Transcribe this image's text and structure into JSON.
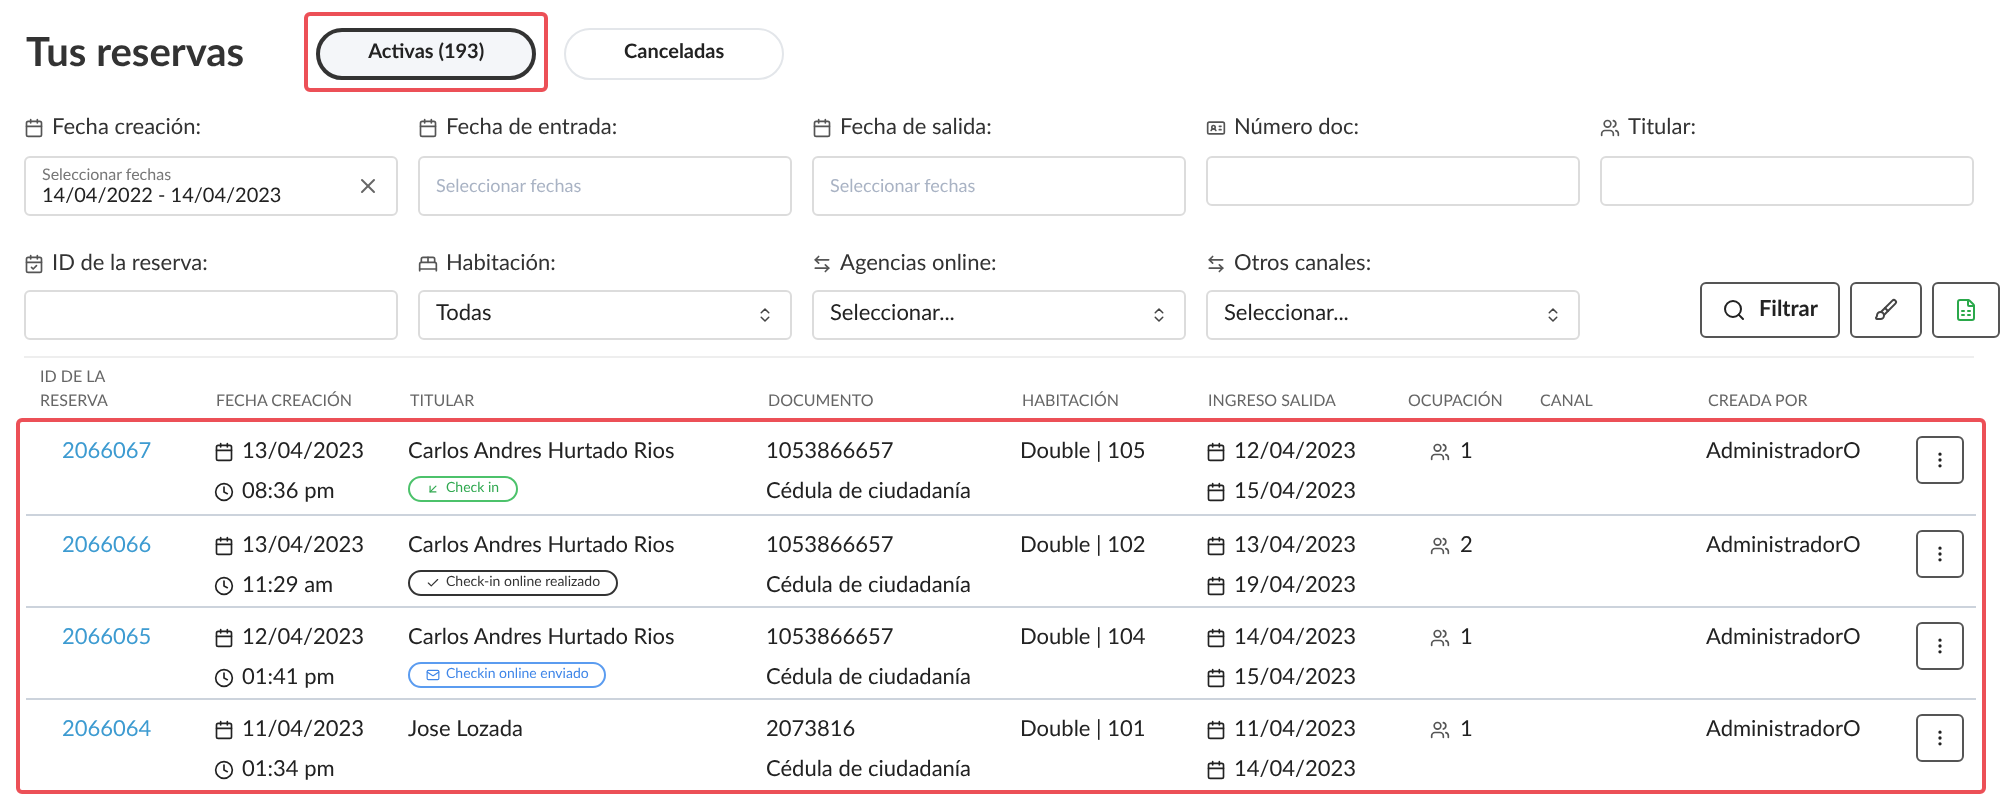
{
  "title": "Tus reservas",
  "tabs": [
    {
      "label": "Activas (193)",
      "selected": true,
      "highlighted": true
    },
    {
      "label": "Canceladas",
      "selected": false,
      "highlighted": false
    }
  ],
  "filters": [
    {
      "kind": "date",
      "label": "Fecha creación:",
      "placeholder": "Seleccionar fechas",
      "value": "14/04/2022 - 14/04/2023"
    },
    {
      "kind": "date",
      "label": "Fecha de entrada:",
      "placeholder": "Seleccionar fechas"
    },
    {
      "kind": "date",
      "label": "Fecha de salida:",
      "placeholder": "Seleccionar fechas"
    },
    {
      "kind": "text",
      "label": "Número doc:"
    },
    {
      "kind": "text",
      "label": "Titular:"
    },
    {
      "kind": "text",
      "label": "ID de la reserva:"
    },
    {
      "kind": "select",
      "label": "Habitación:",
      "value": "Todas"
    },
    {
      "kind": "select",
      "label": "Agencias online:",
      "value": "Seleccionar..."
    },
    {
      "kind": "select",
      "label": "Otros canales:",
      "value": "Seleccionar..."
    }
  ],
  "filter_button": "Filtrar",
  "table": {
    "highlighted": true,
    "columns": [
      "ID DE LA RESERVA",
      "FECHA CREACIÓN",
      "TITULAR",
      "DOCUMENTO",
      "HABITACIÓN",
      "INGRESO SALIDA",
      "OCUPACIÓN",
      "CANAL",
      "CREADA POR"
    ],
    "rows": [
      {
        "id": "2066067",
        "date": "13/04/2023",
        "time": "08:36 pm",
        "holder": "Carlos Andres Hurtado Rios",
        "badge": {
          "kind": "checkin",
          "label": "Check in"
        },
        "doc_number": "1053866657",
        "doc_type": "Cédula de ciudadanía",
        "room": "Double | 105",
        "check_in": "12/04/2023",
        "check_out": "15/04/2023",
        "occupancy": "1",
        "created_by": "AdministradorO"
      },
      {
        "id": "2066066",
        "date": "13/04/2023",
        "time": "11:29 am",
        "holder": "Carlos Andres Hurtado Rios",
        "badge": {
          "kind": "done",
          "label": "Check-in online realizado"
        },
        "doc_number": "1053866657",
        "doc_type": "Cédula de ciudadanía",
        "room": "Double | 102",
        "check_in": "13/04/2023",
        "check_out": "19/04/2023",
        "occupancy": "2",
        "created_by": "AdministradorO"
      },
      {
        "id": "2066065",
        "date": "12/04/2023",
        "time": "01:41 pm",
        "holder": "Carlos Andres Hurtado Rios",
        "badge": {
          "kind": "sent",
          "label": "Checkin online enviado"
        },
        "doc_number": "1053866657",
        "doc_type": "Cédula de ciudadanía",
        "room": "Double | 104",
        "check_in": "14/04/2023",
        "check_out": "15/04/2023",
        "occupancy": "1",
        "created_by": "AdministradorO"
      },
      {
        "id": "2066064",
        "date": "11/04/2023",
        "time": "01:34 pm",
        "holder": "Jose Lozada",
        "doc_number": "2073816",
        "doc_type": "Cédula de ciudadanía",
        "room": "Double | 101",
        "check_in": "11/04/2023",
        "check_out": "14/04/2023",
        "occupancy": "1",
        "created_by": "AdministradorO"
      }
    ]
  }
}
